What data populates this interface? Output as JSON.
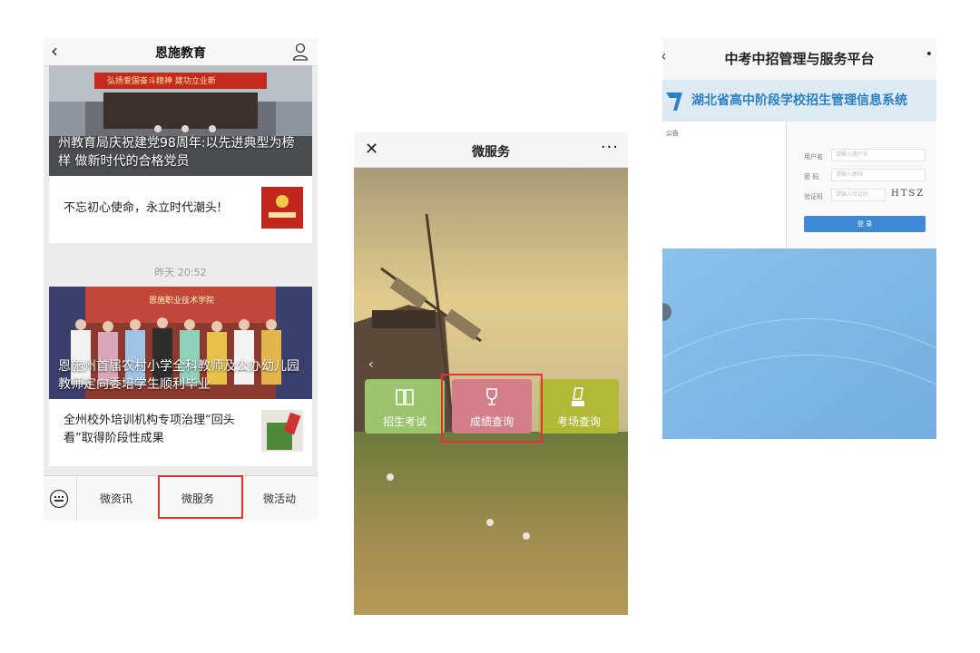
{
  "screen1": {
    "title": "恩施教育",
    "items": [
      {
        "caption": "州教育局庆祝建党98周年:以先进典型为榜样 做新时代的合格党员",
        "banner": "弘扬爱国奋斗精神   建功立业新"
      },
      {
        "text": "不忘初心使命，永立时代潮头!"
      }
    ],
    "timestamp": "昨天 20:52",
    "items2": [
      {
        "caption": "恩施州首届农村小学全科教师及公办幼儿园教师定向委培学生顺利毕业",
        "banner": "恩施职业技术学院"
      },
      {
        "text": "全州校外培训机构专项治理“回头看”取得阶段性成果"
      }
    ],
    "tabs": [
      "微资讯",
      "微服务",
      "微活动"
    ],
    "highlight_color": "#e0332f"
  },
  "screen2": {
    "title": "微服务",
    "more": "···",
    "services": [
      {
        "label": "招生考试",
        "icon": "book-icon",
        "color": "#9cc46f"
      },
      {
        "label": "成绩查询",
        "icon": "trophy-icon",
        "color": "#d47e8a"
      },
      {
        "label": "考场查询",
        "icon": "exam-venue-icon",
        "color": "#b1b936"
      }
    ]
  },
  "screen3": {
    "title": "中考中招管理与服务平台",
    "system_name": "湖北省高中阶段学校招生管理信息系统",
    "notice_title": "公告",
    "fields": [
      {
        "label": "用户名",
        "placeholder": "请输入用户名"
      },
      {
        "label": "密  码",
        "placeholder": "请输入密码"
      },
      {
        "label": "验证码",
        "placeholder": "请输入验证码"
      }
    ],
    "captcha": "HTSZ",
    "login_label": "登 录",
    "accent": "#3f88d6"
  }
}
